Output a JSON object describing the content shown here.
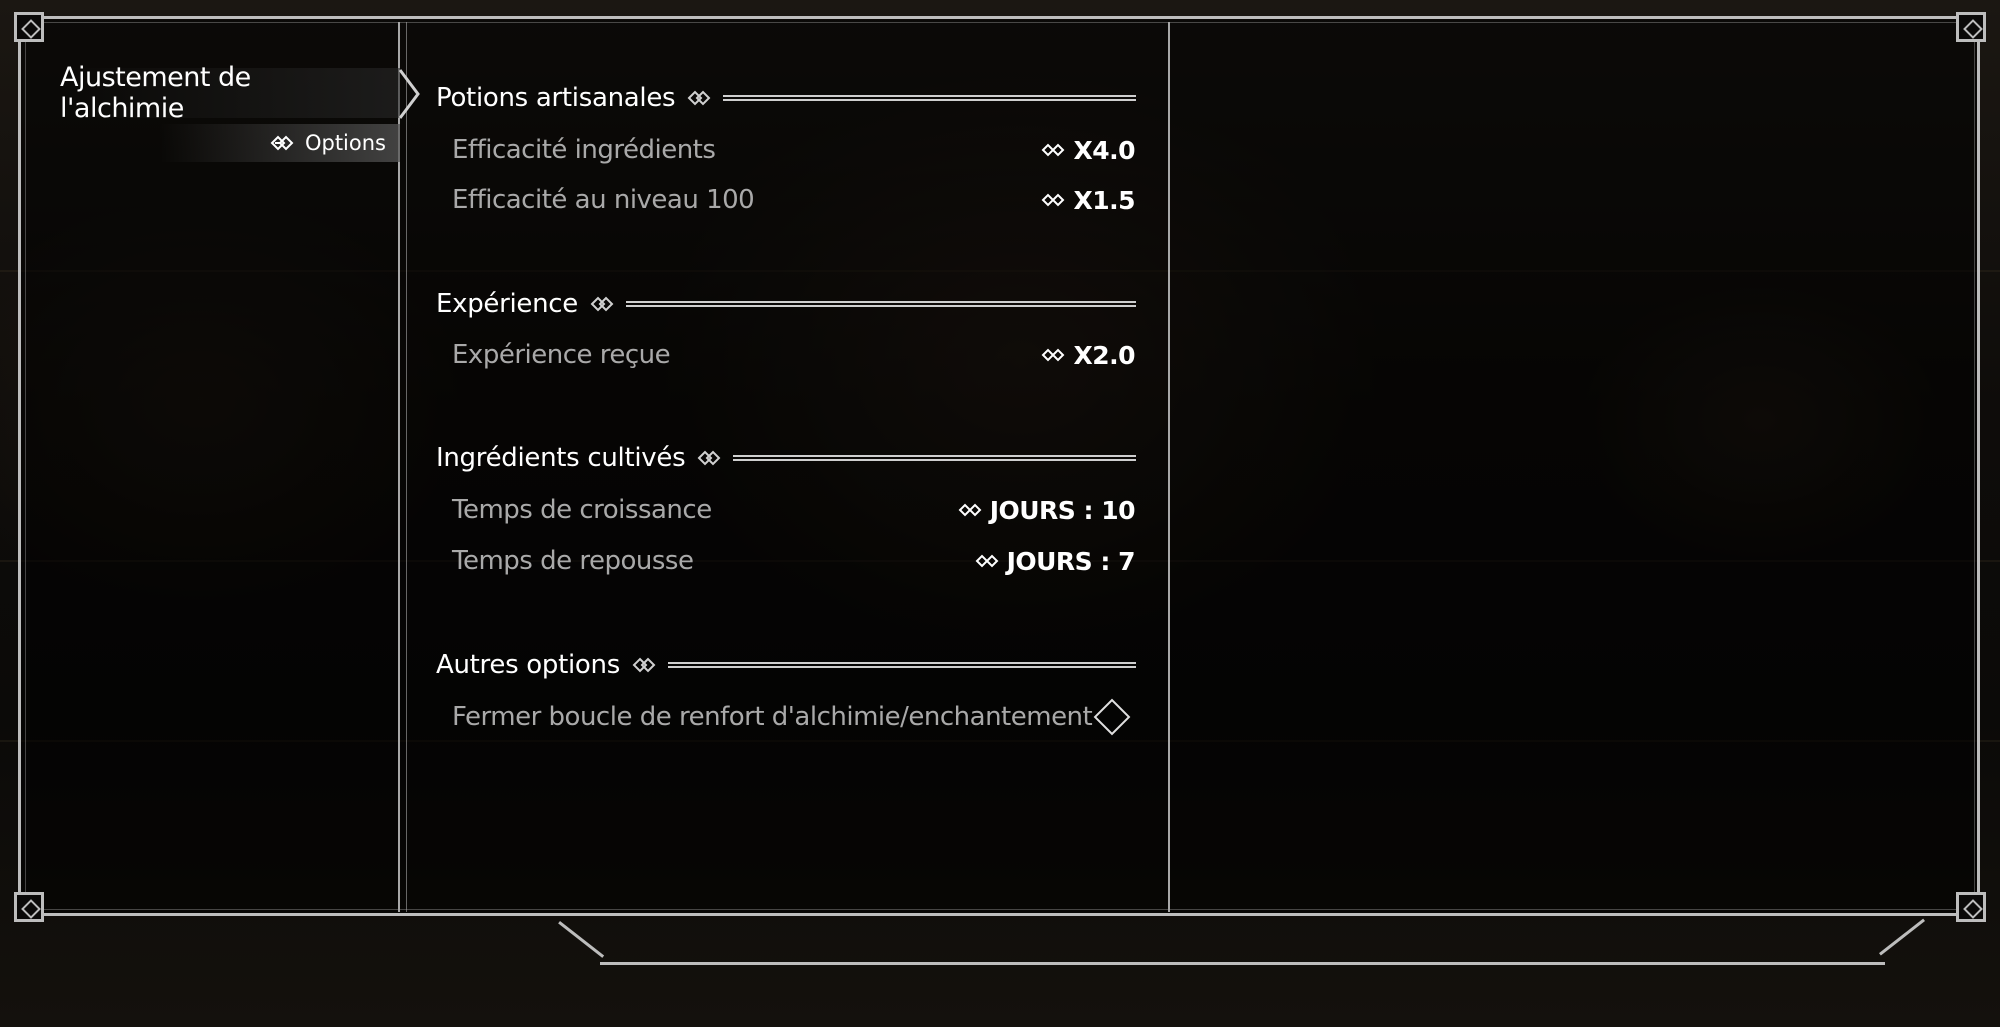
{
  "nav": {
    "title": "Ajustement de l'alchimie",
    "sub_label": "Options",
    "sub_icon": "knot-icon"
  },
  "sections": [
    {
      "header": "Potions artisanales",
      "rows": [
        {
          "label": "Efficacité ingrédients",
          "value": "X4.0"
        },
        {
          "label": "Efficacité au niveau 100",
          "value": "X1.5"
        }
      ]
    },
    {
      "header": "Expérience",
      "rows": [
        {
          "label": "Expérience reçue",
          "value": "X2.0"
        }
      ]
    },
    {
      "header": "Ingrédients cultivés",
      "rows": [
        {
          "label": "Temps de croissance",
          "value": "JOURS : 10"
        },
        {
          "label": "Temps de repousse",
          "value": "JOURS : 7"
        }
      ]
    },
    {
      "header": "Autres options",
      "rows": [
        {
          "label": "Fermer boucle de renfort d'alchimie/enchantement",
          "value": "",
          "toggle": "off"
        }
      ]
    }
  ],
  "colors": {
    "frame": "#bdbdbd",
    "text_active": "#ffffff",
    "text_inactive": "#a9a9a9"
  }
}
